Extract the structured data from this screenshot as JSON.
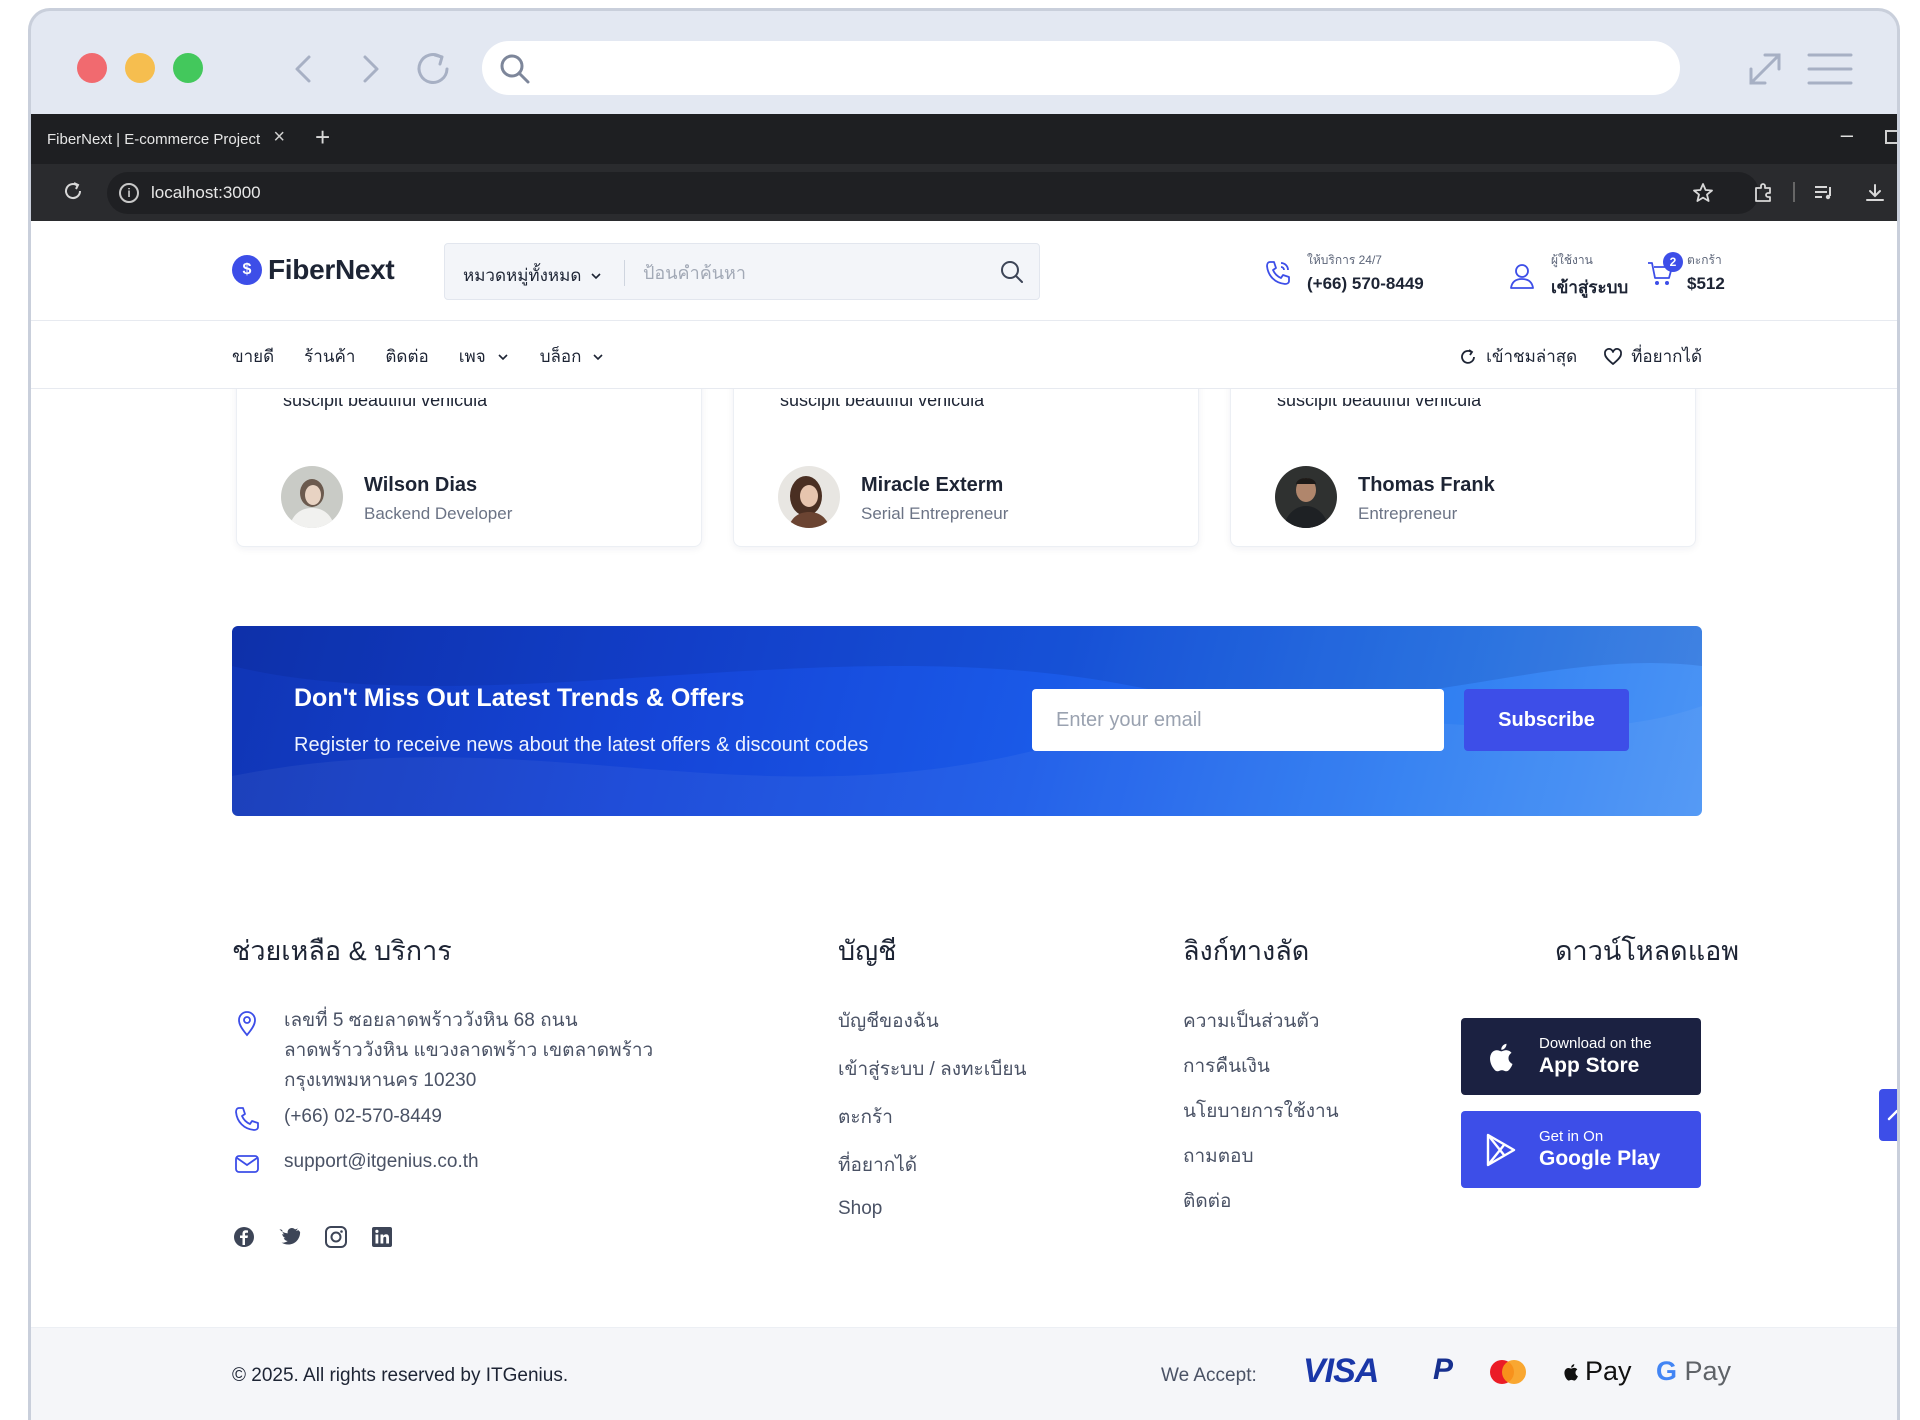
{
  "browser": {
    "tab_title": "FiberNext | E-commerce Project",
    "tab_close": "×",
    "new_tab": "+",
    "minimize": "–",
    "url": "localhost:3000"
  },
  "header": {
    "logo_mark": "$",
    "logo_text": "FiberNext",
    "search_category": "หมวดหมู่ทั้งหมด",
    "search_placeholder": "ป้อนคำค้นหา",
    "support_label": "ให้บริการ 24/7",
    "support_phone": "(+66) 570-8449",
    "user_label": "ผู้ใช้งาน",
    "user_action": "เข้าสู่ระบบ",
    "cart_label": "ตะกร้า",
    "cart_total": "$512",
    "cart_count": "2"
  },
  "nav": {
    "links": [
      "ขายดี",
      "ร้านค้า",
      "ติดต่อ",
      "เพจ",
      "บล็อก"
    ],
    "recent": "เข้าชมล่าสุด",
    "wishlist": "ที่อยากได้"
  },
  "testimonials": [
    {
      "snippet": "suscipit beautiful vehicula",
      "name": "Wilson Dias",
      "role": "Backend Developer"
    },
    {
      "snippet": "suscipit beautiful vehicula",
      "name": "Miracle Exterm",
      "role": "Serial Entrepreneur"
    },
    {
      "snippet": "suscipit beautiful vehicula",
      "name": "Thomas Frank",
      "role": "Entrepreneur"
    }
  ],
  "newsletter": {
    "title": "Don't Miss Out Latest Trends & Offers",
    "subtitle": "Register to receive news about the latest offers & discount codes",
    "email_placeholder": "Enter your email",
    "button": "Subscribe"
  },
  "footer": {
    "help_title": "ช่วยเหลือ & บริการ",
    "address_line1": "เลขที่ 5 ซอยลาดพร้าววังหิน 68 ถนน",
    "address_line2": "ลาดพร้าววังหิน แขวงลาดพร้าว เขตลาดพร้าว",
    "address_line3": "กรุงเทพมหานคร 10230",
    "phone": "(+66) 02-570-8449",
    "email": "support@itgenius.co.th",
    "account_title": "บัญชี",
    "account_links": [
      "บัญชีของฉัน",
      "เข้าสู่ระบบ / ลงทะเบียน",
      "ตะกร้า",
      "ที่อยากได้",
      "Shop"
    ],
    "quick_title": "ลิงก์ทางลัด",
    "quick_links": [
      "ความเป็นส่วนตัว",
      "การคืนเงิน",
      "นโยบายการใช้งาน",
      "ถามตอบ",
      "ติดต่อ"
    ],
    "app_title": "ดาวน์โหลดแอพ",
    "appstore_small": "Download on the",
    "appstore_big": "App Store",
    "googleplay_small": "Get in On",
    "googleplay_big": "Google Play"
  },
  "bottom": {
    "copyright": "© 2025. All rights reserved by ITGenius.",
    "we_accept": "We Accept:",
    "visa": "VISA",
    "paypal": "P",
    "applepay": "Pay",
    "gpay_g": "G",
    "gpay": " Pay"
  },
  "colors": {
    "accent": "#3d4ee8",
    "dark": "#1d2434",
    "appstore_bg": "#1b2141"
  }
}
